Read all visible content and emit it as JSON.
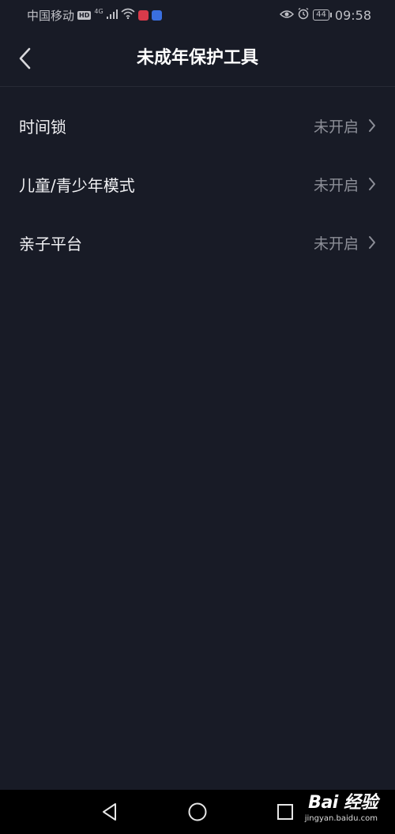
{
  "status_bar": {
    "carrier": "中国移动",
    "hd": "HD",
    "network": "4G",
    "battery": "44",
    "time": "09:58"
  },
  "header": {
    "title": "未成年保护工具"
  },
  "settings": {
    "items": [
      {
        "label": "时间锁",
        "status": "未开启"
      },
      {
        "label": "儿童/青少年模式",
        "status": "未开启"
      },
      {
        "label": "亲子平台",
        "status": "未开启"
      }
    ]
  },
  "watermark": {
    "brand": "Bai 经验",
    "url": "jingyan.baidu.com"
  },
  "colors": {
    "background": "#181b26",
    "status_text": "#8d8f98",
    "divider": "#272a35"
  }
}
